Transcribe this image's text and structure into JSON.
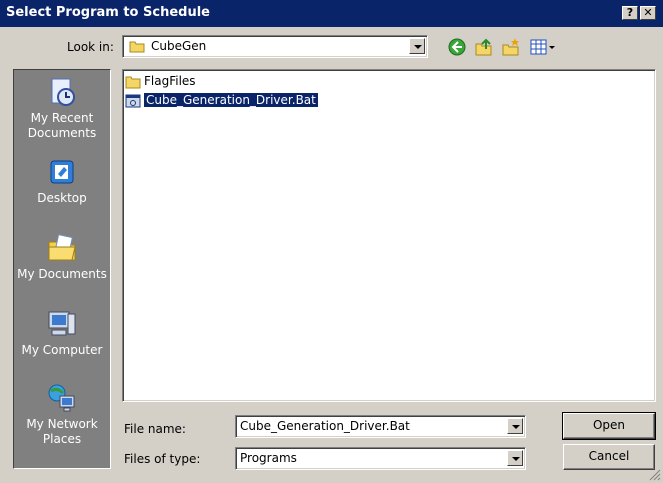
{
  "window": {
    "title": "Select Program to Schedule",
    "help_glyph": "?",
    "close_glyph": "✕"
  },
  "lookin": {
    "label": "Look in:",
    "value": "CubeGen"
  },
  "toolbar": {
    "icons": [
      "back-icon",
      "up-folder-icon",
      "new-folder-icon",
      "view-menu-icon"
    ]
  },
  "places": [
    {
      "label": "My Recent Documents",
      "icon": "recent-documents-icon"
    },
    {
      "label": "Desktop",
      "icon": "desktop-icon"
    },
    {
      "label": "My Documents",
      "icon": "my-documents-icon"
    },
    {
      "label": "My Computer",
      "icon": "my-computer-icon"
    },
    {
      "label": "My Network Places",
      "icon": "network-places-icon"
    }
  ],
  "files": [
    {
      "name": "FlagFiles",
      "icon": "folder-icon",
      "selected": false
    },
    {
      "name": "Cube_Generation_Driver.Bat",
      "icon": "batch-file-icon",
      "selected": true
    }
  ],
  "filename": {
    "label": "File name:",
    "value": "Cube_Generation_Driver.Bat"
  },
  "filetype": {
    "label": "Files of type:",
    "value": "Programs"
  },
  "buttons": {
    "open": "Open",
    "cancel": "Cancel"
  }
}
